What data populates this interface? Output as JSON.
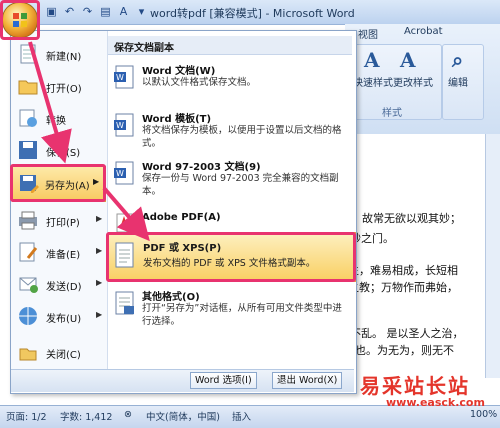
{
  "window": {
    "title": "word转pdf [兼容模式] - Microsoft Word"
  },
  "ribbon": {
    "tabs": [
      "视图",
      "Acrobat"
    ],
    "quick_style": "快速样式",
    "change_style": "更改样式",
    "style_group": "样式",
    "edit": "编辑"
  },
  "menu": {
    "items": [
      {
        "label": "新建(N)"
      },
      {
        "label": "打开(O)"
      },
      {
        "label": "转换"
      },
      {
        "label": "保存(S)"
      },
      {
        "label": "另存为(A)"
      },
      {
        "label": "打印(P)"
      },
      {
        "label": "准备(E)"
      },
      {
        "label": "发送(D)"
      },
      {
        "label": "发布(U)"
      },
      {
        "label": "关闭(C)"
      }
    ],
    "submenu_header": "保存文档副本",
    "submenu": [
      {
        "title": "Word 文档(W)",
        "desc": "以默认文件格式保存文档。"
      },
      {
        "title": "Word 模板(T)",
        "desc": "将文档保存为模板，以便用于设置以后文档的格式。"
      },
      {
        "title": "Word 97-2003 文档(9)",
        "desc": "保存一份与 Word 97-2003 完全兼容的文档副本。"
      },
      {
        "title": "Adobe PDF(A)",
        "desc": ""
      },
      {
        "title": "PDF 或 XPS(P)",
        "desc": "发布文档的 PDF 或 XPS 文件格式副本。"
      },
      {
        "title": "其他格式(O)",
        "desc": "打开“另存为”对话框，从所有可用文件类型中进行选择。"
      }
    ],
    "options_button": "Word 选项(I)",
    "exit_button": "退出 Word(X)"
  },
  "document": {
    "lines": [
      "故常无欲以观其妙；",
      "妙之门。",
      "生，难易相成，长短相",
      "之教；万物作而弗始，",
      "不乱。 是以圣人之治，",
      "也。为无为，则无不"
    ]
  },
  "statusbar": {
    "page": "页面: 1/2",
    "words": "字数: 1,412",
    "lang": "中文(简体，中国)",
    "mode": "插入",
    "zoom": "100%"
  },
  "watermark": {
    "cn": "易采站长站",
    "url": "www.easck.com"
  },
  "colors": {
    "highlight": "#e8336f",
    "selected": "#f8c960",
    "watermark": "#e4352b"
  }
}
